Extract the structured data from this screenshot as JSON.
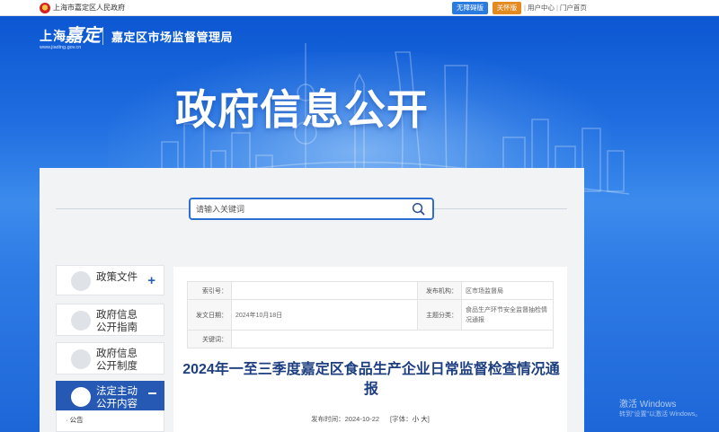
{
  "topbar": {
    "gov_name": "上海市嘉定区人民政府",
    "accessible_label": "无障碍版",
    "care_label": "关怀版",
    "user_center": "用户中心",
    "portal_home": "门户首页",
    "separator": "|"
  },
  "header": {
    "logo_city": "上海",
    "logo_script": "嘉定",
    "logo_url": "www.jiading.gov.cn",
    "bureau_name": "嘉定区市场监督管理局",
    "hero_title": "政府信息公开"
  },
  "search": {
    "placeholder": "请输入关键词"
  },
  "sidebar": {
    "items": [
      {
        "label": "政策文件",
        "icon": "document-icon"
      },
      {
        "label": "政府信息公开指南",
        "icon": "guide-icon"
      },
      {
        "label": "政府信息公开制度",
        "icon": "rules-icon"
      },
      {
        "label": "法定主动公开内容",
        "icon": "list-icon"
      }
    ],
    "sub_items": [
      "公告"
    ]
  },
  "info": {
    "index_label": "索引号：",
    "index_value": "",
    "publisher_label": "发布机构：",
    "publisher_value": "区市场监督局",
    "date_label": "发文日期：",
    "date_value": "2024年10月18日",
    "category_label": "主题分类：",
    "category_value": "食品生产环节安全监督抽检情况通报",
    "keyword_label": "关键词：",
    "keyword_value": ""
  },
  "article": {
    "title": "2024年一至三季度嘉定区食品生产企业日常监督检查情况通报",
    "publish_time": "发布时间：2024-10-22",
    "font_size_label": "[字体：",
    "font_small": "小",
    "font_large": "大",
    "font_close": "]"
  },
  "watermark": {
    "line1": "激活 Windows",
    "line2": "转到\"设置\"以激活 Windows。"
  },
  "colors": {
    "accent": "#2559b4",
    "accessible": "#2a7be0",
    "care": "#e58a1f",
    "title": "#1d3f80"
  }
}
